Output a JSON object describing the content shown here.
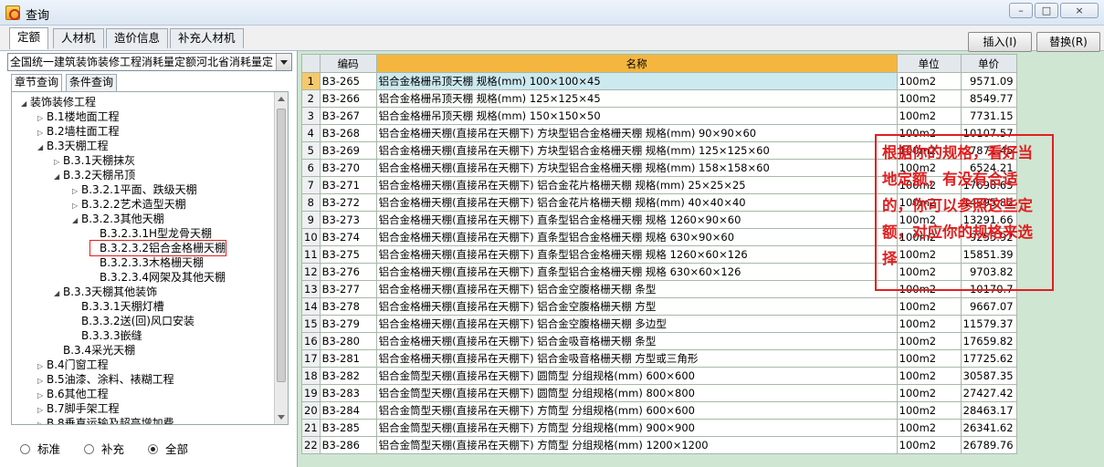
{
  "window": {
    "title": "查询",
    "min_label": "–",
    "max_label": "□",
    "close_label": "×"
  },
  "tabs": [
    "定额",
    "人材机",
    "造价信息",
    "补充人材机"
  ],
  "buttons": {
    "insert": "插入(I)",
    "replace": "替换(R)"
  },
  "library_select": {
    "value": "全国统一建筑装饰装修工程消耗量定额河北省消耗量定"
  },
  "subtabs": [
    "章节查询",
    "条件查询"
  ],
  "tree": [
    {
      "level": 0,
      "arrow": "◢",
      "label": "装饰装修工程"
    },
    {
      "level": 1,
      "arrow": "▷",
      "label": "B.1楼地面工程"
    },
    {
      "level": 1,
      "arrow": "▷",
      "label": "B.2墙柱面工程"
    },
    {
      "level": 1,
      "arrow": "◢",
      "label": "B.3天棚工程"
    },
    {
      "level": 2,
      "arrow": "▷",
      "label": "B.3.1天棚抹灰"
    },
    {
      "level": 2,
      "arrow": "◢",
      "label": "B.3.2天棚吊顶"
    },
    {
      "level": 3,
      "arrow": "▷",
      "label": "B.3.2.1平面、跌级天棚"
    },
    {
      "level": 3,
      "arrow": "▷",
      "label": "B.3.2.2艺术造型天棚"
    },
    {
      "level": 3,
      "arrow": "◢",
      "label": "B.3.2.3其他天棚"
    },
    {
      "level": 4,
      "arrow": "",
      "label": "B.3.2.3.1H型龙骨天棚"
    },
    {
      "level": 4,
      "arrow": "",
      "label": "B.3.2.3.2铝合金格栅天棚",
      "highlight": true
    },
    {
      "level": 4,
      "arrow": "",
      "label": "B.3.2.3.3木格栅天棚"
    },
    {
      "level": 4,
      "arrow": "",
      "label": "B.3.2.3.4网架及其他天棚"
    },
    {
      "level": 2,
      "arrow": "◢",
      "label": "B.3.3天棚其他装饰"
    },
    {
      "level": 3,
      "arrow": "",
      "label": "B.3.3.1天棚灯槽"
    },
    {
      "level": 3,
      "arrow": "",
      "label": "B.3.3.2送(回)风口安装"
    },
    {
      "level": 3,
      "arrow": "",
      "label": "B.3.3.3嵌缝"
    },
    {
      "level": 2,
      "arrow": "",
      "label": "B.3.4采光天棚"
    },
    {
      "level": 1,
      "arrow": "▷",
      "label": "B.4门窗工程"
    },
    {
      "level": 1,
      "arrow": "▷",
      "label": "B.5油漆、涂料、裱糊工程"
    },
    {
      "level": 1,
      "arrow": "▷",
      "label": "B.6其他工程"
    },
    {
      "level": 1,
      "arrow": "▷",
      "label": "B.7脚手架工程"
    },
    {
      "level": 1,
      "arrow": "▷",
      "label": "B.8垂直运输及超高增加费"
    }
  ],
  "radios": [
    {
      "label": "标准",
      "checked": false
    },
    {
      "label": "补充",
      "checked": false
    },
    {
      "label": "全部",
      "checked": true
    }
  ],
  "table": {
    "headers": [
      "",
      "编码",
      "名称",
      "单位",
      "单价"
    ],
    "rows": [
      [
        "1",
        "B3-265",
        "铝合金格栅吊顶天棚 规格(mm) 100×100×45",
        "100m2",
        "9571.09"
      ],
      [
        "2",
        "B3-266",
        "铝合金格栅吊顶天棚 规格(mm) 125×125×45",
        "100m2",
        "8549.77"
      ],
      [
        "3",
        "B3-267",
        "铝合金格栅吊顶天棚 规格(mm) 150×150×50",
        "100m2",
        "7731.15"
      ],
      [
        "4",
        "B3-268",
        "铝合金格栅天棚(直接吊在天棚下) 方块型铝合金格栅天棚 规格(mm) 90×90×60",
        "100m2",
        "10107.57"
      ],
      [
        "5",
        "B3-269",
        "铝合金格栅天棚(直接吊在天棚下) 方块型铝合金格栅天棚 规格(mm) 125×125×60",
        "100m2",
        "7871.45"
      ],
      [
        "6",
        "B3-270",
        "铝合金格栅天棚(直接吊在天棚下) 方块型铝合金格栅天棚 规格(mm) 158×158×60",
        "100m2",
        "6524.21"
      ],
      [
        "7",
        "B3-271",
        "铝合金格栅天棚(直接吊在天棚下) 铝合金花片格栅天棚 规格(mm) 25×25×25",
        "100m2",
        "17698.65"
      ],
      [
        "8",
        "B3-272",
        "铝合金格栅天棚(直接吊在天棚下) 铝合金花片格栅天棚 规格(mm) 40×40×40",
        "100m2",
        "14395.82"
      ],
      [
        "9",
        "B3-273",
        "铝合金格栅天棚(直接吊在天棚下) 直条型铝合金格栅天棚 规格 1260×90×60",
        "100m2",
        "13291.66"
      ],
      [
        "10",
        "B3-274",
        "铝合金格栅天棚(直接吊在天棚下) 直条型铝合金格栅天棚 规格 630×90×60",
        "100m2",
        "9255.92"
      ],
      [
        "11",
        "B3-275",
        "铝合金格栅天棚(直接吊在天棚下) 直条型铝合金格栅天棚 规格 1260×60×126",
        "100m2",
        "15851.39"
      ],
      [
        "12",
        "B3-276",
        "铝合金格栅天棚(直接吊在天棚下) 直条型铝合金格栅天棚 规格 630×60×126",
        "100m2",
        "9703.82"
      ],
      [
        "13",
        "B3-277",
        "铝合金格栅天棚(直接吊在天棚下) 铝合金空腹格栅天棚 条型",
        "100m2",
        "10170.7"
      ],
      [
        "14",
        "B3-278",
        "铝合金格栅天棚(直接吊在天棚下) 铝合金空腹格栅天棚 方型",
        "100m2",
        "9667.07"
      ],
      [
        "15",
        "B3-279",
        "铝合金格栅天棚(直接吊在天棚下) 铝合金空腹格栅天棚 多边型",
        "100m2",
        "11579.37"
      ],
      [
        "16",
        "B3-280",
        "铝合金格栅天棚(直接吊在天棚下) 铝合金吸音格栅天棚 条型",
        "100m2",
        "17659.82"
      ],
      [
        "17",
        "B3-281",
        "铝合金格栅天棚(直接吊在天棚下) 铝合金吸音格栅天棚 方型或三角形",
        "100m2",
        "17725.62"
      ],
      [
        "18",
        "B3-282",
        "铝合金筒型天棚(直接吊在天棚下) 圆筒型 分组规格(mm) 600×600",
        "100m2",
        "30587.35"
      ],
      [
        "19",
        "B3-283",
        "铝合金筒型天棚(直接吊在天棚下) 圆筒型 分组规格(mm) 800×800",
        "100m2",
        "27427.42"
      ],
      [
        "20",
        "B3-284",
        "铝合金筒型天棚(直接吊在天棚下) 方筒型 分组规格(mm) 600×600",
        "100m2",
        "28463.17"
      ],
      [
        "21",
        "B3-285",
        "铝合金筒型天棚(直接吊在天棚下) 方筒型 分组规格(mm) 900×900",
        "100m2",
        "26341.62"
      ],
      [
        "22",
        "B3-286",
        "铝合金筒型天棚(直接吊在天棚下) 方筒型 分组规格(mm) 1200×1200",
        "100m2",
        "26789.76"
      ]
    ]
  },
  "annotation": {
    "text": "根据你的规格，看好当地定额，有没有合适的，你可以参照这些定额，对应你的规格来选择"
  }
}
